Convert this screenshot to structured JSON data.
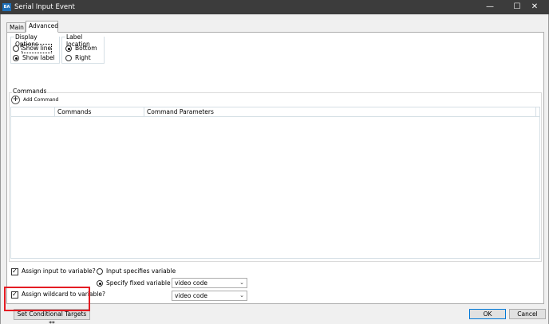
{
  "window": {
    "title": "Serial Input Event",
    "app_icon_text": "BA",
    "minimize_glyph": "—",
    "maximize_glyph": "☐",
    "close_glyph": "✕"
  },
  "tabs": [
    {
      "label": "Main",
      "selected": false
    },
    {
      "label": "Advanced",
      "selected": true
    }
  ],
  "display_options": {
    "title": "Display Options",
    "show_line": "Show line",
    "show_label": "Show label"
  },
  "label_location": {
    "title": "Label location",
    "bottom": "Bottom",
    "right": "Right"
  },
  "commands": {
    "title": "Commands",
    "add_label": "Add Command",
    "columns": [
      "",
      "Commands",
      "Command Parameters"
    ]
  },
  "assign": {
    "assign_input_label": "Assign input to variable?",
    "input_specifies_label": "Input specifies variable",
    "specify_fixed_label": "Specify fixed variable",
    "fixed_variable_value": "video code",
    "assign_wildcard_label": "Assign wildcard to variable?",
    "wildcard_variable_value": "video code"
  },
  "buttons": {
    "conditional_targets": "Set Conditional Targets **",
    "ok": "OK",
    "cancel": "Cancel"
  },
  "colors": {
    "titlebar": "#3c3c3c",
    "highlight": "#e41c23",
    "default_button_border": "#0078d7"
  }
}
